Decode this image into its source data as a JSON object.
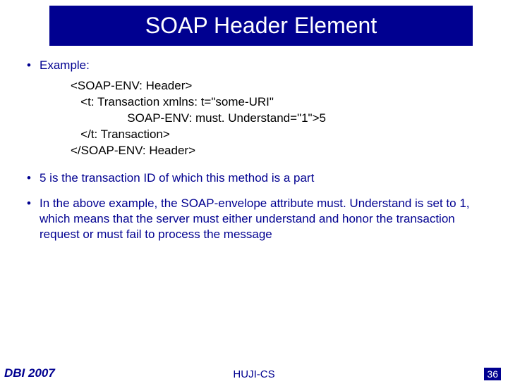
{
  "title": "SOAP Header Element",
  "bullet_example": "Example:",
  "code": {
    "l1": "<SOAP-ENV: Header>",
    "l2": "   <t: Transaction xmlns: t=\"some-URI\"",
    "l3": "                 SOAP-ENV: must. Understand=\"1\">5",
    "l4": "   </t: Transaction>",
    "l5": "</SOAP-ENV: Header>"
  },
  "bullet2": "5 is the transaction ID of which this method is a part",
  "bullet3": "In the above example, the SOAP-envelope attribute must. Understand is set to 1, which means that the server must either understand and honor the transaction request or must fail to process the message",
  "footer": {
    "left": "DBI 2007",
    "center": "HUJI-CS",
    "page": "36"
  }
}
